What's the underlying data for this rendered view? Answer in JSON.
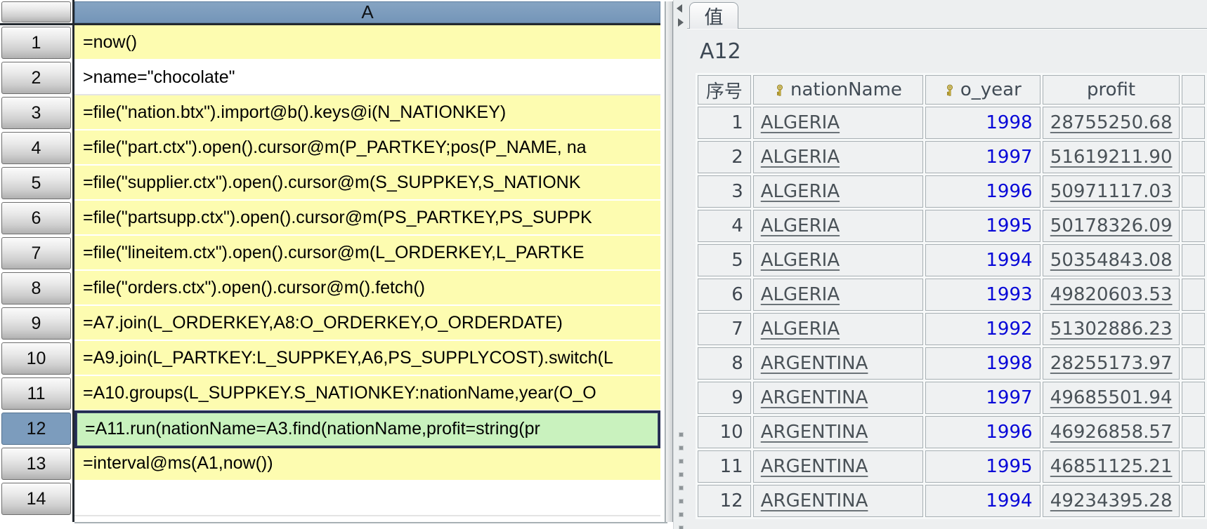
{
  "grid": {
    "column_header": "A",
    "rows": [
      {
        "n": "1",
        "f": "=now()"
      },
      {
        "n": "2",
        "f": ">name=\"chocolate\""
      },
      {
        "n": "3",
        "f": "=file(\"nation.btx\").import@b().keys@i(N_NATIONKEY)"
      },
      {
        "n": "4",
        "f": "=file(\"part.ctx\").open().cursor@m(P_PARTKEY;pos(P_NAME, na"
      },
      {
        "n": "5",
        "f": "=file(\"supplier.ctx\").open().cursor@m(S_SUPPKEY,S_NATIONK"
      },
      {
        "n": "6",
        "f": "=file(\"partsupp.ctx\").open().cursor@m(PS_PARTKEY,PS_SUPPK"
      },
      {
        "n": "7",
        "f": "=file(\"lineitem.ctx\").open().cursor@m(L_ORDERKEY,L_PARTKE"
      },
      {
        "n": "8",
        "f": "=file(\"orders.ctx\").open().cursor@m().fetch()"
      },
      {
        "n": "9",
        "f": "=A7.join(L_ORDERKEY,A8:O_ORDERKEY,O_ORDERDATE)"
      },
      {
        "n": "10",
        "f": "=A9.join(L_PARTKEY:L_SUPPKEY,A6,PS_SUPPLYCOST).switch(L"
      },
      {
        "n": "11",
        "f": "=A10.groups(L_SUPPKEY.S_NATIONKEY:nationName,year(O_O"
      },
      {
        "n": "12",
        "f": "=A11.run(nationName=A3.find(nationName,profit=string(pr"
      },
      {
        "n": "13",
        "f": "=interval@ms(A1,now())"
      },
      {
        "n": "14",
        "f": ""
      }
    ],
    "selected_row": "12"
  },
  "value_panel": {
    "tab_label": "值",
    "cell_ref": "A12",
    "columns": {
      "index": "序号",
      "nation": "nationName",
      "year": "o_year",
      "profit": "profit"
    },
    "key_columns": [
      "nationName",
      "o_year"
    ],
    "rows": [
      {
        "i": "1",
        "nation": "ALGERIA",
        "year": "1998",
        "profit": "28755250.68"
      },
      {
        "i": "2",
        "nation": "ALGERIA",
        "year": "1997",
        "profit": "51619211.90"
      },
      {
        "i": "3",
        "nation": "ALGERIA",
        "year": "1996",
        "profit": "50971117.03"
      },
      {
        "i": "4",
        "nation": "ALGERIA",
        "year": "1995",
        "profit": "50178326.09"
      },
      {
        "i": "5",
        "nation": "ALGERIA",
        "year": "1994",
        "profit": "50354843.08"
      },
      {
        "i": "6",
        "nation": "ALGERIA",
        "year": "1993",
        "profit": "49820603.53"
      },
      {
        "i": "7",
        "nation": "ALGERIA",
        "year": "1992",
        "profit": "51302886.23"
      },
      {
        "i": "8",
        "nation": "ARGENTINA",
        "year": "1998",
        "profit": "28255173.97"
      },
      {
        "i": "9",
        "nation": "ARGENTINA",
        "year": "1997",
        "profit": "49685501.94"
      },
      {
        "i": "10",
        "nation": "ARGENTINA",
        "year": "1996",
        "profit": "46926858.57"
      },
      {
        "i": "11",
        "nation": "ARGENTINA",
        "year": "1995",
        "profit": "46851125.21"
      },
      {
        "i": "12",
        "nation": "ARGENTINA",
        "year": "1994",
        "profit": "49234395.28"
      }
    ]
  },
  "colors": {
    "cell_yellow": "#fdfcb0",
    "cell_green_selected": "#c9f2be",
    "header_blue": "#7c9cbd",
    "selection_border": "#232c52",
    "year_blue": "#0707d8",
    "panel_bg": "#edeff0",
    "key_gold": "#e8cc52"
  }
}
